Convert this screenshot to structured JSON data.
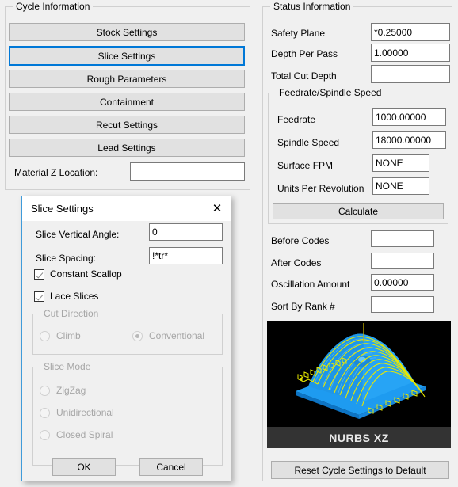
{
  "left_panel": {
    "legend": "Cycle Information",
    "buttons": [
      {
        "label": "Stock Settings",
        "focused": false
      },
      {
        "label": "Slice Settings",
        "focused": true
      },
      {
        "label": "Rough Parameters",
        "focused": false
      },
      {
        "label": "Containment",
        "focused": false
      },
      {
        "label": "Recut Settings",
        "focused": false
      },
      {
        "label": "Lead Settings",
        "focused": false
      }
    ],
    "material_z": {
      "label": "Material Z Location:",
      "value": ""
    }
  },
  "right_panel": {
    "legend": "Status Information",
    "fields": [
      {
        "label": "Safety Plane",
        "value": "*0.25000"
      },
      {
        "label": "Depth Per Pass",
        "value": "1.00000"
      },
      {
        "label": "Total Cut Depth",
        "value": ""
      }
    ],
    "feed_group": {
      "legend": "Feedrate/Spindle Speed",
      "fields": [
        {
          "label": "Feedrate",
          "value": "1000.00000"
        },
        {
          "label": "Spindle Speed",
          "value": "18000.00000"
        },
        {
          "label": "Surface FPM",
          "value": "NONE"
        },
        {
          "label": "Units Per Revolution",
          "value": "NONE"
        }
      ],
      "calculate_label": "Calculate"
    },
    "codes": [
      {
        "label": "Before Codes",
        "value": ""
      },
      {
        "label": "After Codes",
        "value": ""
      },
      {
        "label": "Oscillation Amount",
        "value": "0.00000"
      },
      {
        "label": "Sort By Rank #",
        "value": ""
      }
    ],
    "preview": {
      "caption": "NURBS XZ",
      "background": "#000000",
      "part_color": "#1e9bf0",
      "toolpath_color": "#e8e800"
    },
    "reset_label": "Reset Cycle Settings to Default"
  },
  "dialog": {
    "title": "Slice Settings",
    "close_icon": "✕",
    "accent_color": "#3f9bda",
    "fields": [
      {
        "label": "Slice Vertical Angle:",
        "value": "0"
      },
      {
        "label": "Slice Spacing:",
        "value": "!*tr*"
      }
    ],
    "checkboxes": [
      {
        "label": "Constant Scallop",
        "checked": true
      },
      {
        "label": "Lace Slices",
        "checked": true
      }
    ],
    "cut_direction": {
      "legend": "Cut Direction",
      "options": [
        {
          "label": "Climb",
          "selected": false
        },
        {
          "label": "Conventional",
          "selected": true
        }
      ]
    },
    "slice_mode": {
      "legend": "Slice Mode",
      "options": [
        {
          "label": "ZigZag",
          "selected": false
        },
        {
          "label": "Unidirectional",
          "selected": false
        },
        {
          "label": "Closed Spiral",
          "selected": false
        }
      ]
    },
    "ok_label": "OK",
    "cancel_label": "Cancel"
  }
}
